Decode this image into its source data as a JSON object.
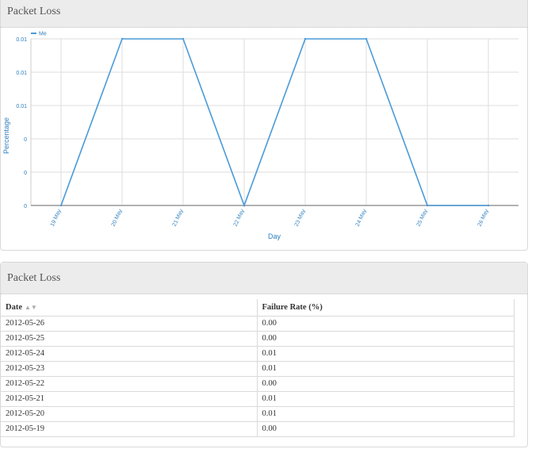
{
  "top_panel": {
    "title": "Packet Loss"
  },
  "bottom_panel": {
    "title": "Packet Loss"
  },
  "colors": {
    "series": "#4a9ad8",
    "axis_text": "#2f7fbf",
    "grid": "#dedede"
  },
  "chart_data": {
    "type": "line",
    "xlabel": "Day",
    "ylabel": "Percentage",
    "x": [
      "19 May",
      "20 May",
      "21 May",
      "22 May",
      "23 May",
      "24 May",
      "25 May",
      "26 May"
    ],
    "series": [
      {
        "name": "Me",
        "values": [
          0.0,
          0.01,
          0.01,
          0.0,
          0.01,
          0.01,
          0.0,
          0.0
        ]
      }
    ],
    "yticks": [
      "0",
      "0",
      "0",
      "0.01",
      "0.01",
      "0.01"
    ],
    "ylim": [
      0,
      0.01
    ],
    "grid": true,
    "legend": "top-left"
  },
  "table": {
    "headers": [
      "Date",
      "Failure Rate (%)"
    ],
    "sort_icon": "sort-icon",
    "rows": [
      [
        "2012-05-26",
        "0.00"
      ],
      [
        "2012-05-25",
        "0.00"
      ],
      [
        "2012-05-24",
        "0.01"
      ],
      [
        "2012-05-23",
        "0.01"
      ],
      [
        "2012-05-22",
        "0.00"
      ],
      [
        "2012-05-21",
        "0.01"
      ],
      [
        "2012-05-20",
        "0.01"
      ],
      [
        "2012-05-19",
        "0.00"
      ]
    ]
  }
}
